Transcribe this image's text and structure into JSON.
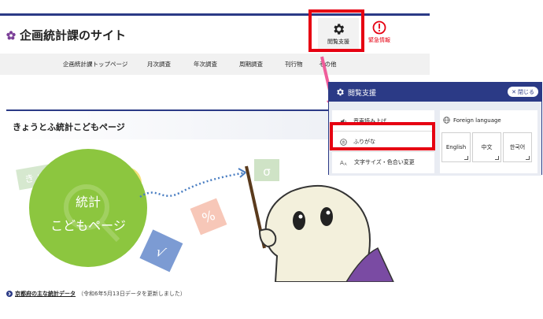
{
  "header": {
    "site_title": "企画統計課のサイト",
    "support_label": "閲覧支援",
    "emergency_label": "緊急情報"
  },
  "nav": {
    "items": [
      "企画統計課トップページ",
      "月次調査",
      "年次調査",
      "周期調査",
      "刊行物",
      "その他"
    ]
  },
  "main": {
    "heading": "きょうとふ統計こどもページ",
    "hero": {
      "tag": "きょうとふ",
      "circle_line1": "統計",
      "circle_line2": "こどもページ",
      "sigma": "σ",
      "percent": "%",
      "root": "√"
    },
    "bottom_link": "京都府の主な統計データ",
    "bottom_note": "（令和6年5月13日データを更新しました）"
  },
  "panel": {
    "title": "閲覧支援",
    "close_label": "閉じる",
    "options": [
      "音声読み上げ",
      "ふりがな",
      "文字サイズ・色合い変更"
    ],
    "foreign_title": "Foreign language",
    "languages": [
      "English",
      "中文",
      "한국어"
    ]
  },
  "colors": {
    "navy": "#2b3a86",
    "highlight_red": "#e60012",
    "arrow_pink": "#ef5c9a",
    "circle_green": "#8cc63f"
  }
}
